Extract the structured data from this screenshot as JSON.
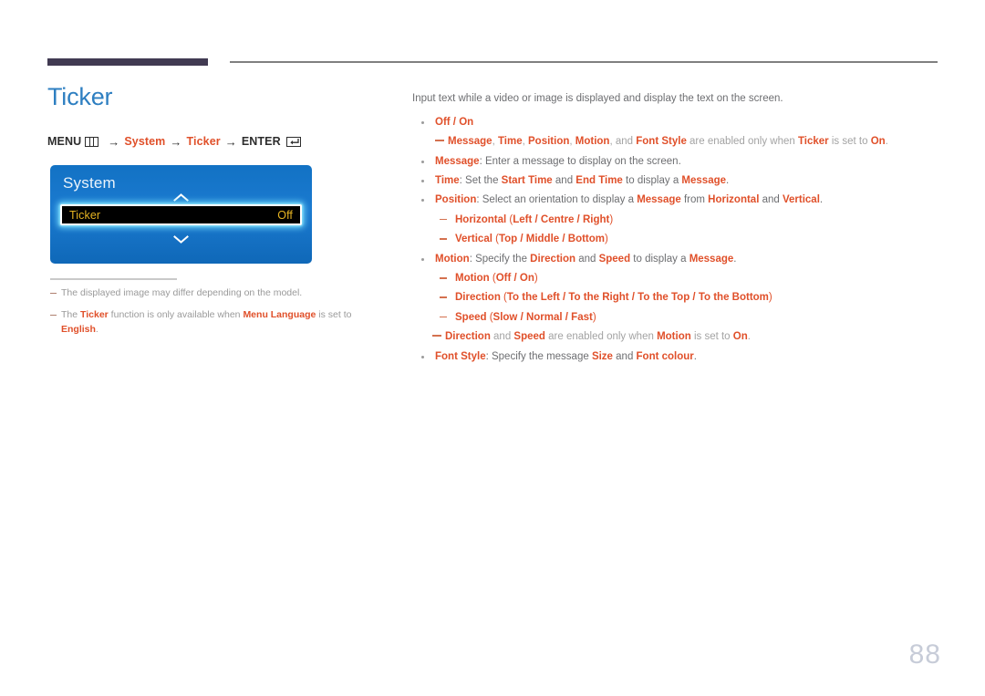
{
  "header": {
    "rule_thick_color": "#413a52",
    "rule_thin_color": "#808080"
  },
  "left": {
    "title": "Ticker",
    "title_color": "#2e7fc1",
    "menu_path": {
      "menu_label": "MENU",
      "menu_icon": "menu-grid-icon",
      "arrow": "→",
      "step1": "System",
      "step2": "Ticker",
      "enter_label": "ENTER",
      "enter_icon": "enter-return-icon"
    },
    "osd": {
      "title": "System",
      "chevron_up": "chevron-up-icon",
      "chevron_down": "chevron-down-icon",
      "row_label": "Ticker",
      "row_value": "Off",
      "accent_color": "#e6b422",
      "panel_color": "#1272c4"
    },
    "footnotes": [
      {
        "parts": [
          {
            "t": "The displayed image may differ depending on the model.",
            "b": false
          }
        ]
      },
      {
        "parts": [
          {
            "t": "The ",
            "b": false
          },
          {
            "t": "Ticker",
            "b": true
          },
          {
            "t": " function is only available when ",
            "b": false
          },
          {
            "t": "Menu Language",
            "b": true
          },
          {
            "t": " is set to ",
            "b": false
          },
          {
            "t": "English",
            "b": true
          },
          {
            "t": ".",
            "b": false
          }
        ]
      }
    ]
  },
  "right": {
    "intro": "Input text while a video or image is displayed and display the text on the screen.",
    "items": [
      {
        "marker": "dot",
        "level": 1,
        "parts": [
          {
            "t": "Off / On",
            "b": true
          }
        ]
      },
      {
        "marker": "note",
        "level": "note",
        "muted": true,
        "parts": [
          {
            "t": "Message",
            "b": true
          },
          {
            "t": ", ",
            "b": false
          },
          {
            "t": "Time",
            "b": true
          },
          {
            "t": ", ",
            "b": false
          },
          {
            "t": "Position",
            "b": true
          },
          {
            "t": ", ",
            "b": false
          },
          {
            "t": "Motion",
            "b": true
          },
          {
            "t": ", and ",
            "b": false
          },
          {
            "t": "Font Style",
            "b": true
          },
          {
            "t": " are enabled only when ",
            "b": false
          },
          {
            "t": "Ticker",
            "b": true
          },
          {
            "t": " is set to ",
            "b": false
          },
          {
            "t": "On",
            "b": true
          },
          {
            "t": ".",
            "b": false
          }
        ]
      },
      {
        "marker": "dot",
        "level": 1,
        "parts": [
          {
            "t": "Message",
            "b": true
          },
          {
            "t": ": Enter a message to display on the screen.",
            "b": false
          }
        ]
      },
      {
        "marker": "dot",
        "level": 1,
        "parts": [
          {
            "t": "Time",
            "b": true
          },
          {
            "t": ": Set the ",
            "b": false
          },
          {
            "t": "Start Time",
            "b": true
          },
          {
            "t": " and ",
            "b": false
          },
          {
            "t": "End Time",
            "b": true
          },
          {
            "t": " to display a ",
            "b": false
          },
          {
            "t": "Message",
            "b": true
          },
          {
            "t": ".",
            "b": false
          }
        ]
      },
      {
        "marker": "dot",
        "level": 1,
        "parts": [
          {
            "t": "Position",
            "b": true
          },
          {
            "t": ": Select an orientation to display a ",
            "b": false
          },
          {
            "t": "Message",
            "b": true
          },
          {
            "t": " from ",
            "b": false
          },
          {
            "t": "Horizontal",
            "b": true
          },
          {
            "t": " and ",
            "b": false
          },
          {
            "t": "Vertical",
            "b": true
          },
          {
            "t": ".",
            "b": false
          }
        ]
      },
      {
        "marker": "dash",
        "level": 2,
        "parts": [
          {
            "t": "Horizontal",
            "b": true
          },
          {
            "t": " (",
            "b": false,
            "o": true
          },
          {
            "t": "Left / Centre / Right",
            "b": true
          },
          {
            "t": ")",
            "b": false,
            "o": true
          }
        ]
      },
      {
        "marker": "dash",
        "level": 2,
        "parts": [
          {
            "t": "Vertical",
            "b": true
          },
          {
            "t": " (",
            "b": false,
            "o": true
          },
          {
            "t": "Top / Middle / Bottom",
            "b": true
          },
          {
            "t": ")",
            "b": false,
            "o": true
          }
        ]
      },
      {
        "marker": "dot",
        "level": 1,
        "parts": [
          {
            "t": "Motion",
            "b": true
          },
          {
            "t": ": Specify the ",
            "b": false
          },
          {
            "t": "Direction",
            "b": true
          },
          {
            "t": " and ",
            "b": false
          },
          {
            "t": "Speed",
            "b": true
          },
          {
            "t": " to display a ",
            "b": false
          },
          {
            "t": "Message",
            "b": true
          },
          {
            "t": ".",
            "b": false
          }
        ]
      },
      {
        "marker": "dash",
        "level": 2,
        "parts": [
          {
            "t": "Motion",
            "b": true
          },
          {
            "t": " (",
            "b": false,
            "o": true
          },
          {
            "t": "Off / On",
            "b": true
          },
          {
            "t": ")",
            "b": false,
            "o": true
          }
        ]
      },
      {
        "marker": "dash",
        "level": 2,
        "parts": [
          {
            "t": "Direction",
            "b": true
          },
          {
            "t": " (",
            "b": false,
            "o": true
          },
          {
            "t": "To the Left / To the Right / To the Top / To the Bottom",
            "b": true
          },
          {
            "t": ")",
            "b": false,
            "o": true
          }
        ]
      },
      {
        "marker": "dash",
        "level": 2,
        "parts": [
          {
            "t": "Speed",
            "b": true
          },
          {
            "t": " (",
            "b": false,
            "o": true
          },
          {
            "t": "Slow / Normal / Fast",
            "b": true
          },
          {
            "t": ")",
            "b": false,
            "o": true
          }
        ]
      },
      {
        "marker": "note",
        "level": "note2",
        "muted": true,
        "parts": [
          {
            "t": "Direction",
            "b": true
          },
          {
            "t": " and ",
            "b": false
          },
          {
            "t": "Speed",
            "b": true
          },
          {
            "t": " are enabled only when ",
            "b": false
          },
          {
            "t": "Motion",
            "b": true
          },
          {
            "t": " is set to ",
            "b": false
          },
          {
            "t": "On",
            "b": true
          },
          {
            "t": ".",
            "b": false
          }
        ]
      },
      {
        "marker": "dot",
        "level": 1,
        "parts": [
          {
            "t": "Font Style",
            "b": true
          },
          {
            "t": ": Specify the message ",
            "b": false
          },
          {
            "t": "Size",
            "b": true
          },
          {
            "t": " and ",
            "b": false
          },
          {
            "t": "Font colour",
            "b": true
          },
          {
            "t": ".",
            "b": false
          }
        ]
      }
    ]
  },
  "page_number": "88"
}
